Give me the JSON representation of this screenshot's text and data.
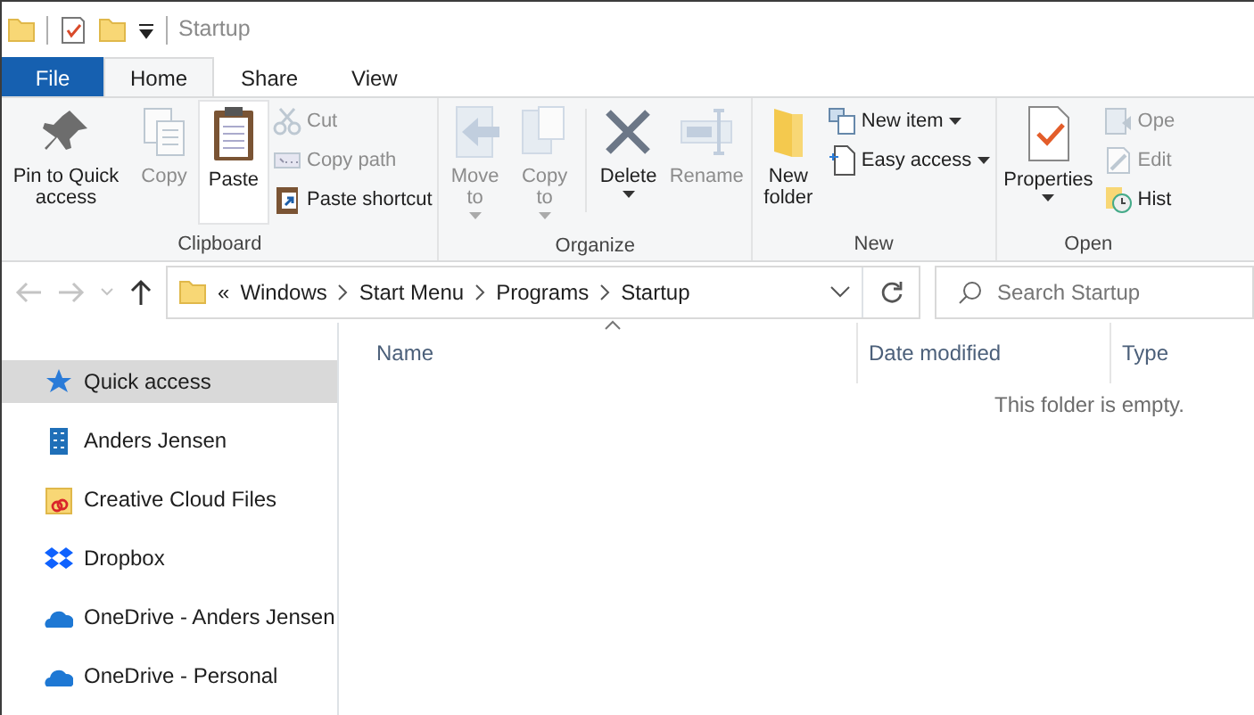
{
  "title_bar": {
    "title": "Startup"
  },
  "ribbon_tabs": [
    {
      "label": "File",
      "kind": "file",
      "selected": false
    },
    {
      "label": "Home",
      "kind": "tab",
      "selected": true
    },
    {
      "label": "Share",
      "kind": "tab",
      "selected": false
    },
    {
      "label": "View",
      "kind": "tab",
      "selected": false
    }
  ],
  "ribbon_groups": [
    {
      "label": "Clipboard",
      "items": [
        {
          "kind": "large",
          "label": "Pin to Quick access",
          "disabled": false,
          "dropdown": false,
          "highlighted": false
        },
        {
          "kind": "large",
          "label": "Copy",
          "disabled": true,
          "dropdown": false,
          "highlighted": false
        },
        {
          "kind": "large",
          "label": "Paste",
          "disabled": false,
          "dropdown": false,
          "highlighted": true
        },
        {
          "kind": "stack",
          "commands": [
            {
              "label": "Cut",
              "disabled": true,
              "dropdown": false
            },
            {
              "label": "Copy path",
              "disabled": true,
              "dropdown": false
            },
            {
              "label": "Paste shortcut",
              "disabled": false,
              "dropdown": false
            }
          ]
        }
      ]
    },
    {
      "label": "Organize",
      "items": [
        {
          "kind": "large",
          "label": "Move to",
          "disabled": true,
          "dropdown": true,
          "highlighted": false
        },
        {
          "kind": "large",
          "label": "Copy to",
          "disabled": true,
          "dropdown": true,
          "highlighted": false
        },
        {
          "kind": "separator"
        },
        {
          "kind": "large",
          "label": "Delete",
          "disabled": false,
          "dropdown": true,
          "highlighted": false
        },
        {
          "kind": "large",
          "label": "Rename",
          "disabled": true,
          "dropdown": false,
          "highlighted": false
        }
      ]
    },
    {
      "label": "New",
      "items": [
        {
          "kind": "large",
          "label": "New folder",
          "disabled": false,
          "dropdown": false,
          "highlighted": false
        },
        {
          "kind": "stack",
          "commands": [
            {
              "label": "New item",
              "disabled": false,
              "dropdown": true
            },
            {
              "label": "Easy access",
              "disabled": false,
              "dropdown": true
            }
          ]
        }
      ]
    },
    {
      "label": "Open",
      "items": [
        {
          "kind": "large",
          "label": "Properties",
          "disabled": false,
          "dropdown": true,
          "highlighted": false
        },
        {
          "kind": "stack",
          "commands": [
            {
              "label": "Ope",
              "disabled": true,
              "dropdown": false
            },
            {
              "label": "Edit",
              "disabled": true,
              "dropdown": false
            },
            {
              "label": "Hist",
              "disabled": false,
              "dropdown": false
            }
          ]
        }
      ]
    }
  ],
  "navigation": {
    "back_disabled": true,
    "forward_disabled": true,
    "up_disabled": false
  },
  "address_bar": {
    "overflow_mark": "«",
    "segments": [
      "Windows",
      "Start Menu",
      "Programs",
      "Startup"
    ]
  },
  "search": {
    "placeholder": "Search Startup"
  },
  "nav_pane": [
    {
      "label": "Quick access",
      "selected": true
    },
    {
      "label": "Anders Jensen",
      "selected": false
    },
    {
      "label": "Creative Cloud Files",
      "selected": false
    },
    {
      "label": "Dropbox",
      "selected": false
    },
    {
      "label": "OneDrive - Anders Jensen",
      "selected": false
    },
    {
      "label": "OneDrive - Personal",
      "selected": false
    }
  ],
  "columns": [
    {
      "label": "Name",
      "sorted": true
    },
    {
      "label": "Date modified",
      "sorted": false
    },
    {
      "label": "Type",
      "sorted": false
    }
  ],
  "empty_message": "This folder is empty."
}
